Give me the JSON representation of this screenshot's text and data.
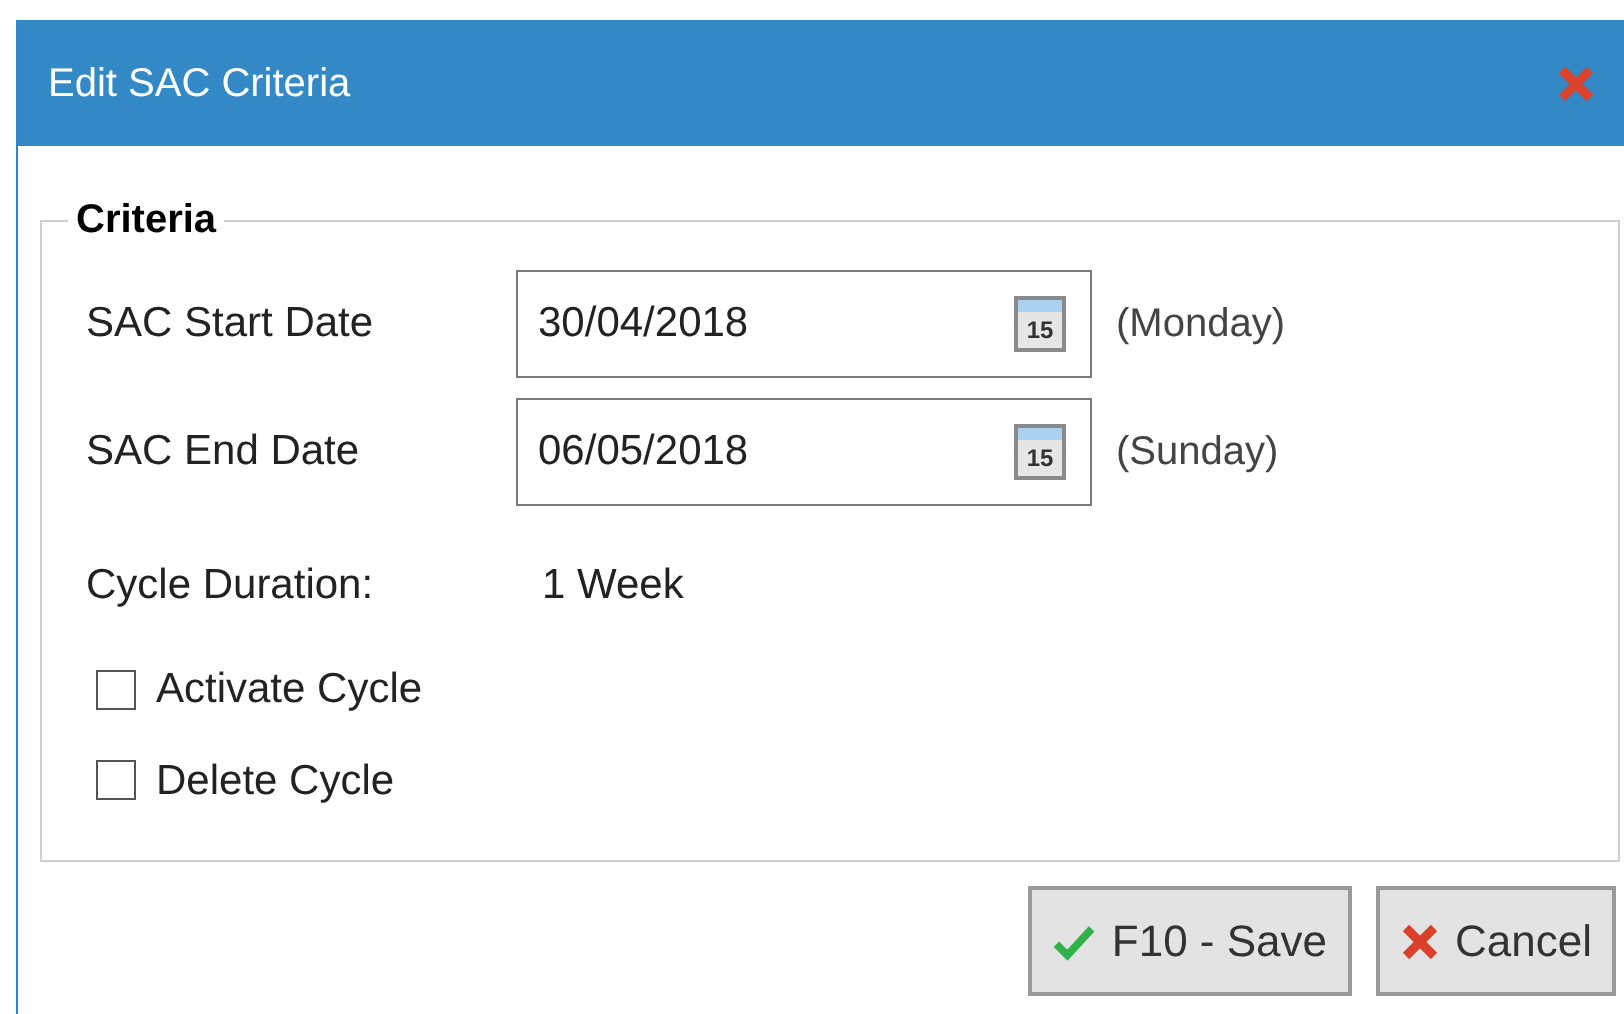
{
  "window": {
    "title": "Edit SAC Criteria"
  },
  "criteria": {
    "legend": "Criteria",
    "dates": [
      {
        "label": "SAC Start Date",
        "value": "30/04/2018",
        "calendar_label": "15",
        "weekday": "(Monday)"
      },
      {
        "label": "SAC End Date",
        "value": "06/05/2018",
        "calendar_label": "15",
        "weekday": "(Sunday)"
      }
    ],
    "duration": {
      "label": "Cycle Duration:",
      "value": "1 Week"
    },
    "checkboxes": [
      {
        "label": "Activate Cycle",
        "checked": false
      },
      {
        "label": "Delete Cycle",
        "checked": false
      }
    ]
  },
  "buttons": [
    {
      "kind": "save",
      "label": "F10 - Save"
    },
    {
      "kind": "cancel",
      "label": "Cancel"
    }
  ]
}
